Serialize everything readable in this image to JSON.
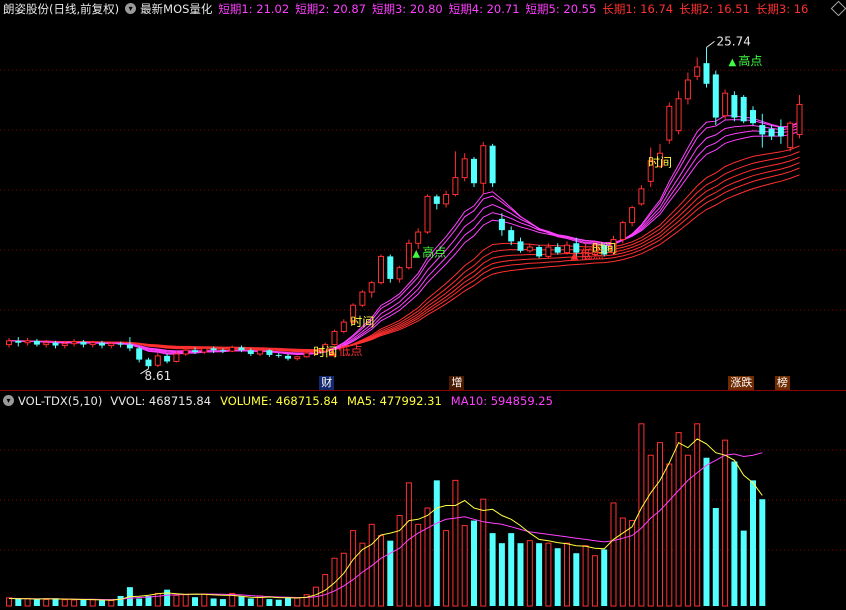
{
  "header": {
    "stock_title": "朗姿股份(日线,前复权)",
    "indicator_menu_icon": "chevron-down-icon",
    "indicator_name": "最新MOS量化",
    "ma_labels": [
      {
        "text": "短期1: 21.02",
        "color": "#ff40ff"
      },
      {
        "text": "短期2: 20.87",
        "color": "#ff40ff"
      },
      {
        "text": "短期3: 20.80",
        "color": "#ff40ff"
      },
      {
        "text": "短期4: 20.71",
        "color": "#ff40ff"
      },
      {
        "text": "短期5: 20.55",
        "color": "#ff40ff"
      },
      {
        "text": "长期1: 16.74",
        "color": "#ff3030"
      },
      {
        "text": "长期2: 16.51",
        "color": "#ff3030"
      },
      {
        "text": "长期3: 16",
        "color": "#ff3030"
      }
    ],
    "scroll_icon": "diamond-icon"
  },
  "volume_header": {
    "name": "VOL-TDX(5,10)",
    "menu_icon": "chevron-down-icon",
    "items": [
      {
        "text": "VVOL: 468715.84",
        "color": "#e8e8e8"
      },
      {
        "text": "VOLUME: 468715.84",
        "color": "#ffff40"
      },
      {
        "text": "MA5: 477992.31",
        "color": "#ffff40"
      },
      {
        "text": "MA10: 594859.25",
        "color": "#ff40ff"
      }
    ]
  },
  "event_tags": [
    {
      "text": "财",
      "bg": "#14286e",
      "color": "#ffffff"
    },
    {
      "text": "增",
      "bg": "#4a1a00",
      "color": "#ffffff"
    },
    {
      "text": "涨跌",
      "bg": "#6e2a00",
      "color": "#ffffff"
    },
    {
      "text": "榜",
      "bg": "#6e2a00",
      "color": "#ffffff"
    }
  ],
  "annotations": [
    {
      "text": "25.74",
      "color": "#e8e8e8",
      "kind": "max-price"
    },
    {
      "text": "8.61",
      "color": "#e8e8e8",
      "kind": "min-price"
    },
    {
      "text": "高点",
      "color": "#40ff40",
      "marker": "▲",
      "marker_color": "#40ff40",
      "kind": "signal"
    },
    {
      "text": "高点",
      "color": "#40ff40",
      "marker": "▲",
      "marker_color": "#40ff40",
      "kind": "signal"
    },
    {
      "text": "低点",
      "color": "#ff3030",
      "marker": "▲",
      "marker_color": "#ff3030",
      "kind": "signal"
    },
    {
      "text": "低点",
      "color": "#ff3030",
      "marker": "▲",
      "marker_color": "#ff3030",
      "kind": "signal"
    },
    {
      "text": "时间",
      "color": "#ffff40",
      "kind": "signal"
    },
    {
      "text": "时间",
      "color": "#ffff40",
      "kind": "signal"
    },
    {
      "text": "时间",
      "color": "#ffff40",
      "kind": "signal"
    },
    {
      "text": "时间",
      "color": "#ffff40",
      "kind": "signal"
    }
  ],
  "colors": {
    "up": "#ff3030",
    "down": "#54ffff",
    "short_ma": "#ff40ff",
    "long_ma": "#ff3030",
    "vol_ma5": "#ffff40",
    "vol_ma10": "#ff40ff",
    "grid": "#8b0000",
    "background": "#000000"
  },
  "chart_data": [
    {
      "type": "candlestick",
      "ylim": [
        7.8,
        27.2
      ],
      "grid": "horizontal dotted",
      "candles": [
        [
          9.9,
          10.1,
          10.25,
          9.75
        ],
        [
          10.1,
          10.0,
          10.3,
          9.8
        ],
        [
          10.0,
          10.1,
          10.25,
          9.85
        ],
        [
          10.1,
          9.9,
          10.2,
          9.8
        ],
        [
          9.9,
          10.0,
          10.15,
          9.75
        ],
        [
          10.0,
          9.85,
          10.1,
          9.7
        ],
        [
          9.85,
          9.95,
          10.1,
          9.7
        ],
        [
          9.95,
          10.05,
          10.2,
          9.8
        ],
        [
          10.05,
          9.9,
          10.15,
          9.75
        ],
        [
          9.9,
          10.0,
          10.1,
          9.75
        ],
        [
          10.0,
          9.85,
          10.1,
          9.7
        ],
        [
          9.85,
          9.95,
          10.05,
          9.7
        ],
        [
          9.95,
          9.9,
          10.05,
          9.75
        ],
        [
          9.9,
          9.7,
          10.3,
          9.55
        ],
        [
          9.7,
          9.1,
          9.8,
          8.95
        ],
        [
          9.1,
          8.75,
          9.2,
          8.61
        ],
        [
          8.8,
          9.3,
          9.45,
          8.7
        ],
        [
          9.3,
          9.0,
          9.4,
          8.9
        ],
        [
          9.0,
          9.4,
          9.55,
          8.95
        ],
        [
          9.4,
          9.6,
          9.7,
          9.3
        ],
        [
          9.6,
          9.5,
          9.75,
          9.4
        ],
        [
          9.5,
          9.7,
          9.8,
          9.4
        ],
        [
          9.7,
          9.6,
          9.8,
          9.45
        ],
        [
          9.6,
          9.55,
          9.7,
          9.45
        ],
        [
          9.55,
          9.75,
          9.85,
          9.5
        ],
        [
          9.75,
          9.6,
          9.85,
          9.5
        ],
        [
          9.6,
          9.4,
          9.7,
          9.3
        ],
        [
          9.4,
          9.6,
          9.7,
          9.3
        ],
        [
          9.6,
          9.35,
          9.65,
          9.25
        ],
        [
          9.35,
          9.3,
          9.45,
          9.2
        ],
        [
          9.3,
          9.15,
          9.4,
          9.05
        ],
        [
          9.15,
          9.25,
          9.3,
          9.05
        ],
        [
          9.25,
          9.45,
          9.55,
          9.2
        ],
        [
          9.45,
          9.55,
          9.65,
          9.35
        ],
        [
          9.55,
          9.9,
          10.0,
          9.45
        ],
        [
          9.9,
          10.6,
          10.7,
          9.85
        ],
        [
          10.6,
          11.1,
          11.25,
          10.5
        ],
        [
          11.1,
          12.0,
          12.1,
          11.0
        ],
        [
          12.0,
          12.7,
          12.8,
          11.9
        ],
        [
          12.7,
          13.2,
          13.3,
          12.4
        ],
        [
          13.2,
          14.6,
          14.7,
          13.1
        ],
        [
          14.6,
          13.4,
          14.7,
          13.2
        ],
        [
          13.4,
          14.0,
          14.1,
          13.2
        ],
        [
          14.0,
          15.3,
          15.5,
          13.9
        ],
        [
          15.3,
          15.9,
          16.1,
          15.0
        ],
        [
          15.9,
          17.8,
          17.9,
          15.8
        ],
        [
          17.8,
          17.4,
          17.9,
          17.1
        ],
        [
          17.4,
          17.9,
          18.1,
          17.2
        ],
        [
          17.9,
          18.8,
          20.2,
          17.8
        ],
        [
          18.8,
          19.8,
          20.1,
          18.6
        ],
        [
          19.8,
          18.5,
          19.9,
          18.3
        ],
        [
          18.5,
          20.5,
          20.7,
          17.9
        ],
        [
          20.5,
          18.5,
          20.6,
          18.3
        ],
        [
          16.6,
          16.0,
          16.9,
          15.7
        ],
        [
          16.0,
          15.4,
          16.2,
          15.2
        ],
        [
          15.4,
          14.9,
          15.6,
          14.8
        ],
        [
          14.9,
          15.1,
          15.3,
          14.8
        ],
        [
          15.1,
          14.6,
          15.2,
          14.5
        ],
        [
          14.6,
          15.1,
          15.3,
          14.5
        ],
        [
          15.1,
          14.8,
          15.3,
          14.7
        ],
        [
          14.8,
          15.2,
          15.4,
          14.7
        ],
        [
          15.3,
          14.8,
          15.6,
          14.5
        ],
        [
          14.6,
          14.8,
          15.3,
          14.5
        ],
        [
          14.7,
          15.2,
          15.4,
          14.6
        ],
        [
          15.2,
          14.7,
          15.3,
          14.6
        ],
        [
          14.8,
          15.5,
          15.7,
          14.7
        ],
        [
          15.5,
          16.4,
          16.5,
          15.3
        ],
        [
          16.4,
          17.2,
          17.3,
          16.2
        ],
        [
          17.4,
          18.2,
          18.4,
          17.3
        ],
        [
          18.6,
          19.7,
          20.4,
          18.3
        ],
        [
          19.4,
          20.1,
          20.6,
          19.3
        ],
        [
          20.8,
          22.6,
          22.8,
          20.6
        ],
        [
          21.3,
          23.0,
          23.4,
          21.1
        ],
        [
          23.0,
          24.0,
          24.4,
          22.7
        ],
        [
          24.2,
          24.7,
          25.2,
          24.0
        ],
        [
          24.9,
          23.8,
          25.74,
          23.6
        ],
        [
          24.3,
          22.0,
          24.5,
          21.6
        ],
        [
          22.1,
          23.3,
          23.5,
          21.9
        ],
        [
          23.2,
          22.0,
          23.4,
          21.8
        ],
        [
          23.1,
          21.8,
          23.2,
          21.7
        ],
        [
          22.4,
          21.7,
          22.6,
          21.6
        ],
        [
          21.6,
          21.1,
          22.2,
          20.4
        ],
        [
          21.4,
          21.0,
          21.6,
          20.8
        ],
        [
          21.5,
          21.0,
          21.9,
          20.6
        ],
        [
          20.4,
          21.7,
          21.8,
          20.2
        ],
        [
          21.1,
          22.7,
          23.2,
          20.9
        ]
      ]
    },
    {
      "type": "bar",
      "ylim": [
        0,
        1560000
      ],
      "grid": "horizontal dotted",
      "values": [
        65000,
        60000,
        58000,
        55000,
        52000,
        62000,
        50000,
        48000,
        54000,
        50000,
        45000,
        44000,
        80000,
        150000,
        60000,
        80000,
        100000,
        130000,
        85000,
        90000,
        70000,
        95000,
        60000,
        55000,
        100000,
        75000,
        60000,
        80000,
        55000,
        50000,
        70000,
        65000,
        90000,
        150000,
        250000,
        380000,
        420000,
        600000,
        500000,
        650000,
        560000,
        520000,
        720000,
        980000,
        650000,
        780000,
        1000000,
        600000,
        1000000,
        640000,
        680000,
        850000,
        580000,
        500000,
        580000,
        500000,
        520000,
        500000,
        500000,
        460000,
        500000,
        420000,
        480000,
        400000,
        450000,
        820000,
        700000,
        680000,
        1450000,
        1200000,
        1300000,
        1130000,
        1380000,
        1200000,
        1450000,
        1180000,
        780000,
        1320000,
        1150000,
        600000,
        1000000,
        850000
      ],
      "series": [
        {
          "name": "MA5",
          "values": [
            60000,
            58000,
            57000,
            55000,
            57000,
            56000,
            55000,
            53000,
            52000,
            51000,
            48000,
            47000,
            53000,
            75000,
            78000,
            85000,
            98000,
            104000,
            98000,
            92000,
            95000,
            93000,
            88000,
            86000,
            84000,
            77000,
            69000,
            68000,
            72000,
            67000,
            65000,
            64000,
            70000,
            89000,
            125000,
            185000,
            260000,
            370000,
            450000,
            490000,
            565000,
            580000,
            600000,
            680000,
            690000,
            720000,
            780000,
            800000,
            800000,
            840000,
            780000,
            760000,
            770000,
            720000,
            690000,
            640000,
            580000,
            530000,
            520000,
            505000,
            495000,
            480000,
            475000,
            460000,
            455000,
            530000,
            580000,
            630000,
            780000,
            900000,
            1000000,
            1140000,
            1300000,
            1260000,
            1330000,
            1290000,
            1220000,
            1200000,
            1160000,
            1040000,
            980000,
            880000
          ]
        },
        {
          "name": "MA10",
          "values": [
            62000,
            60000,
            59000,
            58000,
            57000,
            57000,
            56000,
            55000,
            54000,
            53000,
            52000,
            51000,
            53000,
            62000,
            68000,
            72000,
            78000,
            85000,
            90000,
            92000,
            94000,
            95000,
            95000,
            93000,
            91000,
            88000,
            83000,
            78000,
            75000,
            72000,
            70000,
            68000,
            68000,
            74000,
            90000,
            120000,
            160000,
            210000,
            270000,
            320000,
            380000,
            420000,
            460000,
            530000,
            580000,
            620000,
            660000,
            690000,
            700000,
            710000,
            690000,
            670000,
            660000,
            650000,
            630000,
            610000,
            590000,
            580000,
            570000,
            560000,
            550000,
            540000,
            530000,
            520000,
            510000,
            520000,
            540000,
            560000,
            620000,
            700000,
            760000,
            840000,
            920000,
            1000000,
            1060000,
            1120000,
            1160000,
            1200000,
            1210000,
            1190000,
            1200000,
            1220000
          ]
        }
      ]
    }
  ]
}
